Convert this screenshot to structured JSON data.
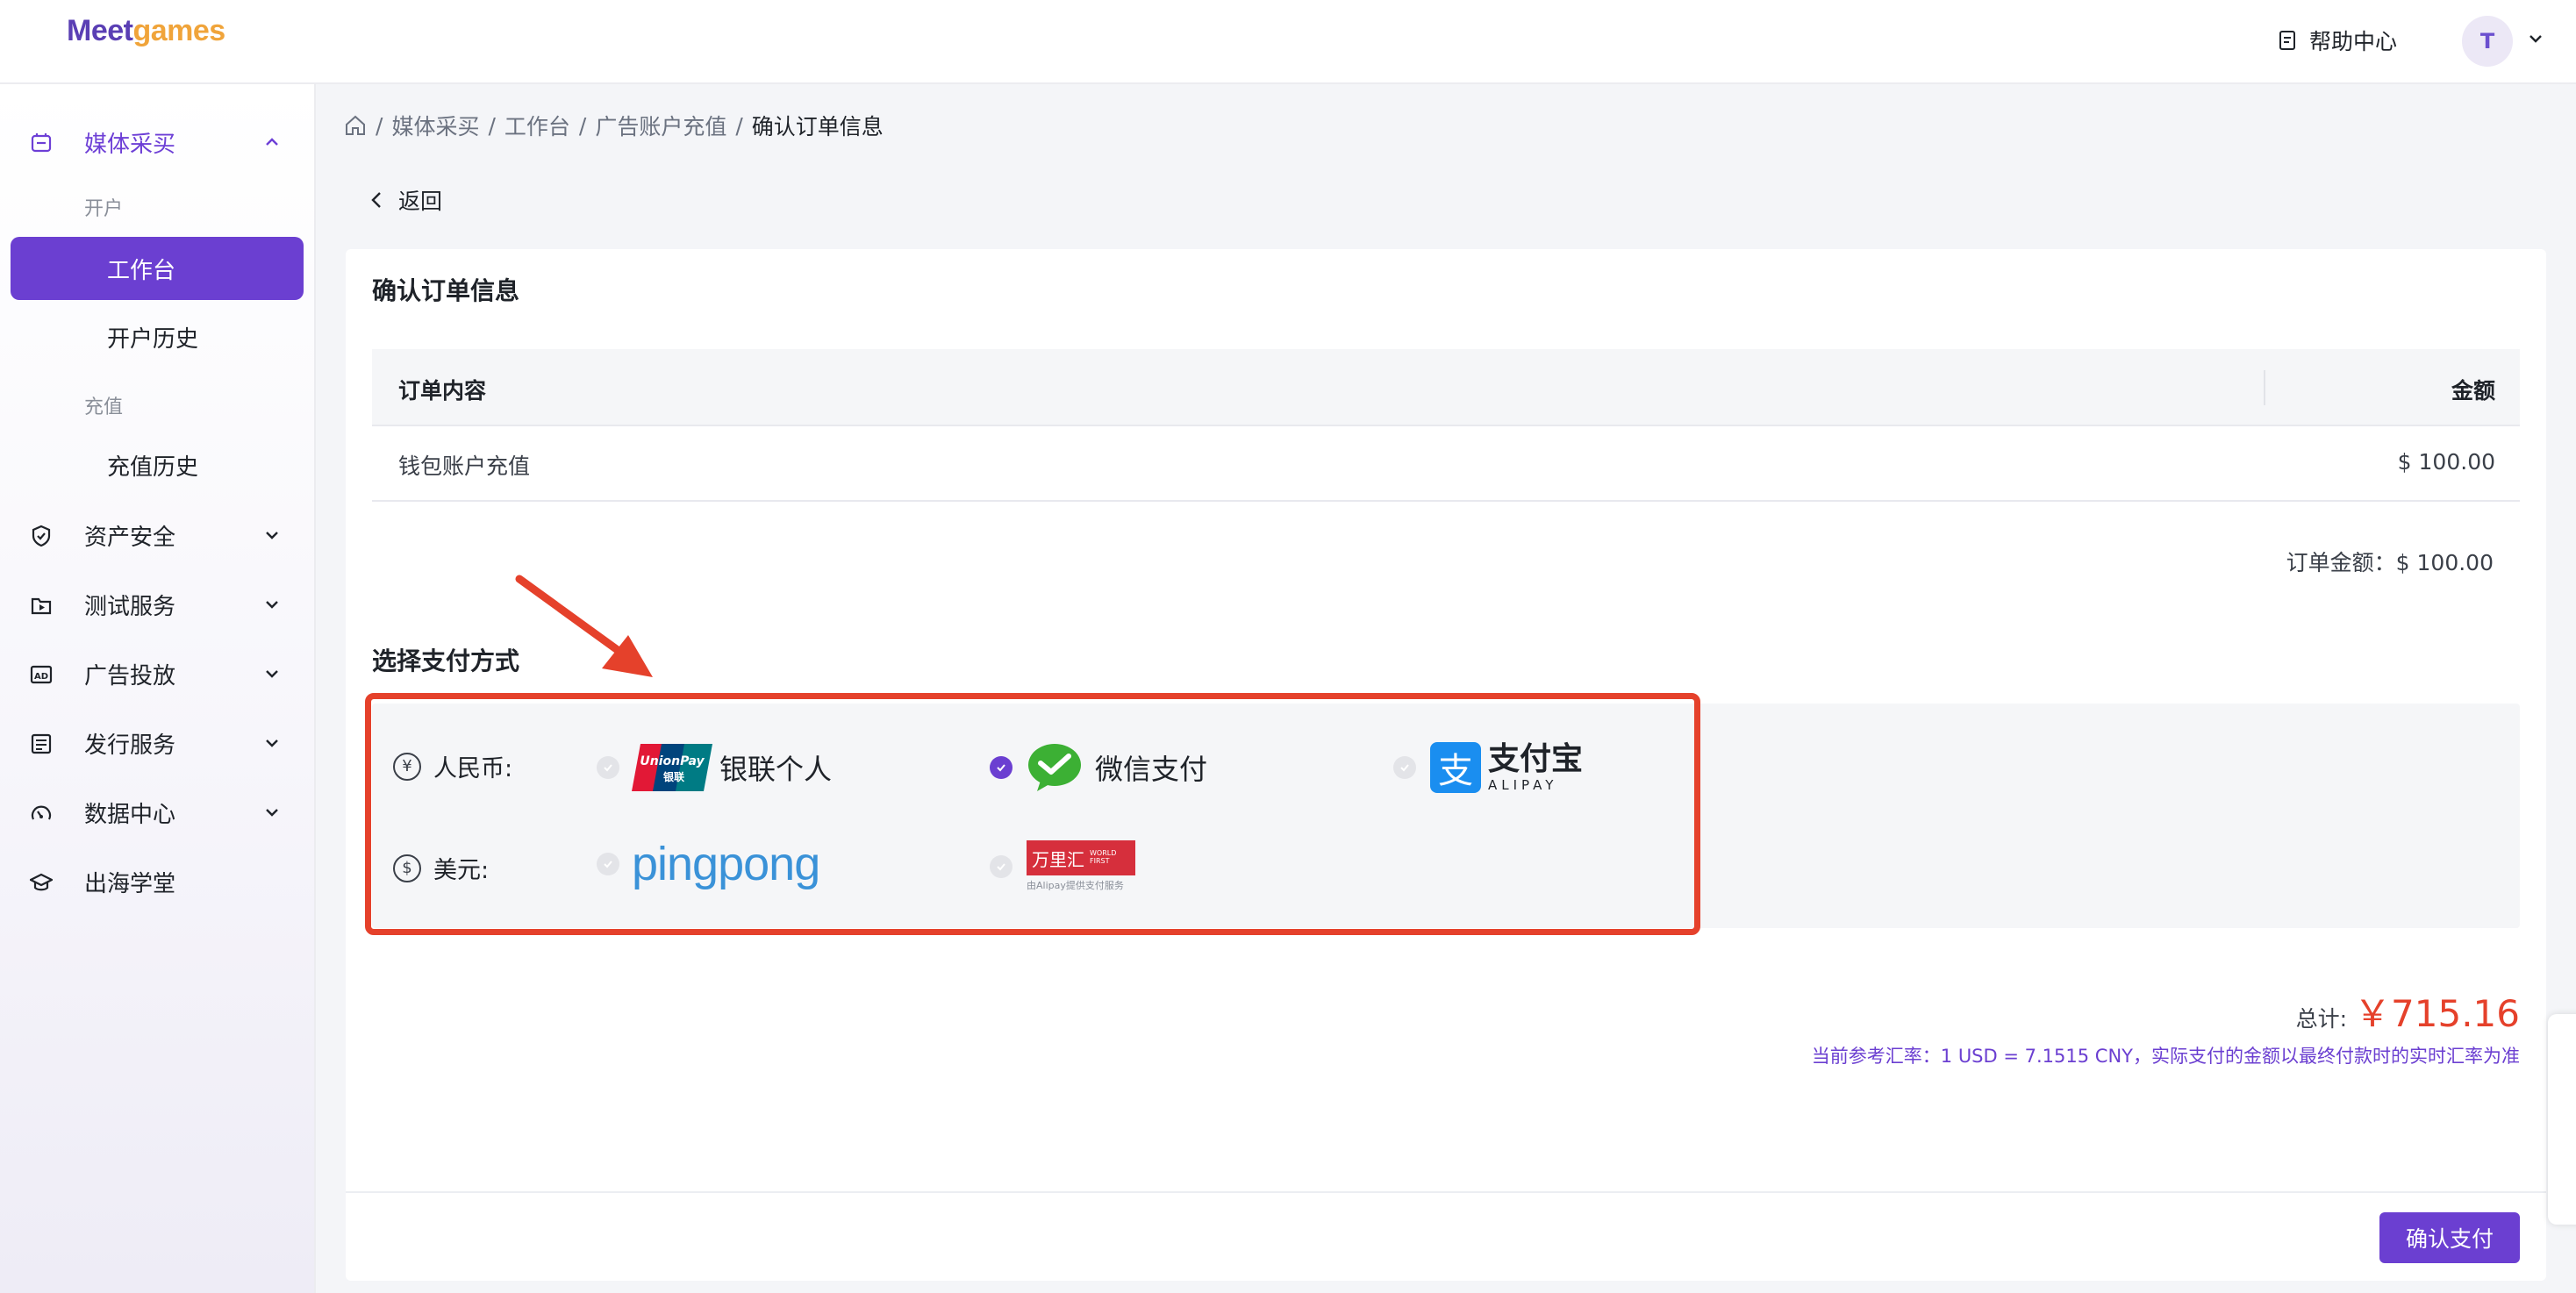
{
  "brand": {
    "logo_part1": "Meet",
    "logo_part2": "games"
  },
  "header": {
    "help": "帮助中心",
    "avatar": "T"
  },
  "sidebar": {
    "media": "媒体采买",
    "group_open": "开户",
    "workbench": "工作台",
    "open_history": "开户历史",
    "group_recharge": "充值",
    "recharge_history": "充值历史",
    "asset_security": "资产安全",
    "test_service": "测试服务",
    "ad_delivery": "广告投放",
    "publish_service": "发行服务",
    "data_center": "数据中心",
    "academy": "出海学堂"
  },
  "breadcrumb": {
    "items": [
      "媒体采买",
      "工作台",
      "广告账户充值"
    ],
    "current": "确认订单信息",
    "sep": "/"
  },
  "back": "返回",
  "card": {
    "title": "确认订单信息",
    "table": {
      "col_content": "订单内容",
      "col_amount": "金额",
      "rows": [
        {
          "content": "钱包账户充值",
          "amount": "$ 100.00"
        }
      ]
    },
    "order_amount": "订单金额：$ 100.00",
    "pay_title": "选择支付方式",
    "rmb_label": "人民币:",
    "usd_label": "美元:",
    "rmb_symbol": "¥",
    "usd_symbol": "$",
    "options": {
      "unionpay": "银联个人",
      "unionpay_logo_top": "UnionPay",
      "unionpay_logo_bottom": "银联",
      "wechat": "微信支付",
      "alipay": "支付宝",
      "alipay_sub": "ALIPAY",
      "alipay_logo": "支",
      "pingpong": "pingpong",
      "worldfirst_cn": "万里汇",
      "worldfirst_en1": "WORLD",
      "worldfirst_en2": "FIRST",
      "worldfirst_sub": "由Alipay提供支付服务"
    },
    "total_label": "总计:",
    "total_value": "￥715.16",
    "rate_note": "当前参考汇率：1 USD = 7.1515 CNY，实际支付的金额以最终付款时的实时汇率为准",
    "confirm": "确认支付"
  },
  "colors": {
    "primary": "#6b3fd1",
    "highlight": "#e5412b",
    "wechat": "#3cb034",
    "alipay": "#1a8ef0"
  },
  "selected_payment": "wechat"
}
